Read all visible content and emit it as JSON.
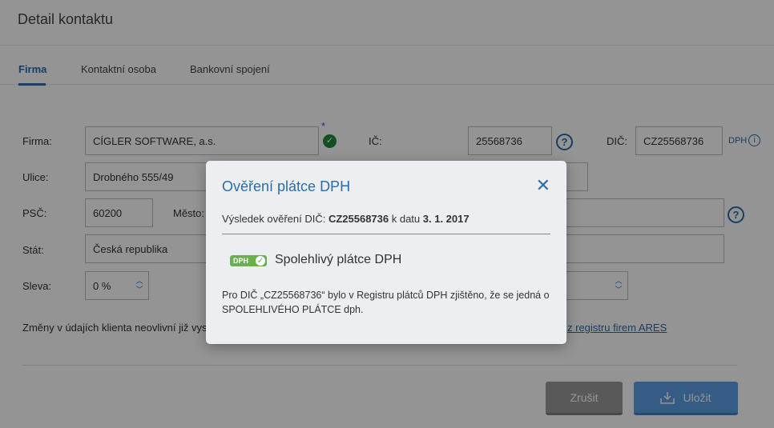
{
  "page": {
    "title": "Detail kontaktu"
  },
  "tabs": [
    {
      "label": "Firma",
      "active": true
    },
    {
      "label": "Kontaktní osoba",
      "active": false
    },
    {
      "label": "Bankovní spojení",
      "active": false
    }
  ],
  "form": {
    "firma": {
      "label": "Firma:",
      "value": "CÍGLER SOFTWARE, a.s.",
      "required_mark": "*"
    },
    "ic": {
      "label": "IČ:",
      "value": "25568736"
    },
    "dic": {
      "label": "DIČ:",
      "value": "CZ25568736",
      "info_label": "DPH"
    },
    "ulice": {
      "label": "Ulice:",
      "value": "Drobného 555/49"
    },
    "psc": {
      "label": "PSČ:",
      "value": "60200"
    },
    "mesto": {
      "label": "Město:"
    },
    "stat": {
      "label": "Stát:",
      "value": "Česká republika"
    },
    "sleva": {
      "label": "Sleva:",
      "value": "0 %"
    },
    "note": "Změny v údajích klienta neovlivní již vyst",
    "ares_link": "z registru firem ARES",
    "help_glyph": "?"
  },
  "buttons": {
    "cancel": "Zrušit",
    "save": "Uložit"
  },
  "modal": {
    "title": "Ověření plátce DPH",
    "close_glyph": "✕",
    "result_prefix": "Výsledek ověření DIČ: ",
    "result_dic": "CZ25568736",
    "result_mid": " k datu ",
    "result_date": "3. 1. 2017",
    "badge_label": "DPH",
    "status": "Spolehlivý plátce DPH",
    "description": "Pro DIČ „CZ25568736“ bylo v Registru plátců DPH zjištěno, že se jedná o SPOLEHLIVÉHO PLÁTCE dph."
  },
  "colors": {
    "accent": "#2c6ca8",
    "success": "#1f8a3a",
    "badge": "#6ab04c",
    "save_button": "#5b9fe3",
    "cancel_button": "#9a9a9a"
  },
  "icons": {
    "check": "check-icon",
    "help": "help-icon",
    "info": "info-icon",
    "close": "close-icon",
    "save": "download-icon",
    "spinner": "spinner-icon"
  }
}
